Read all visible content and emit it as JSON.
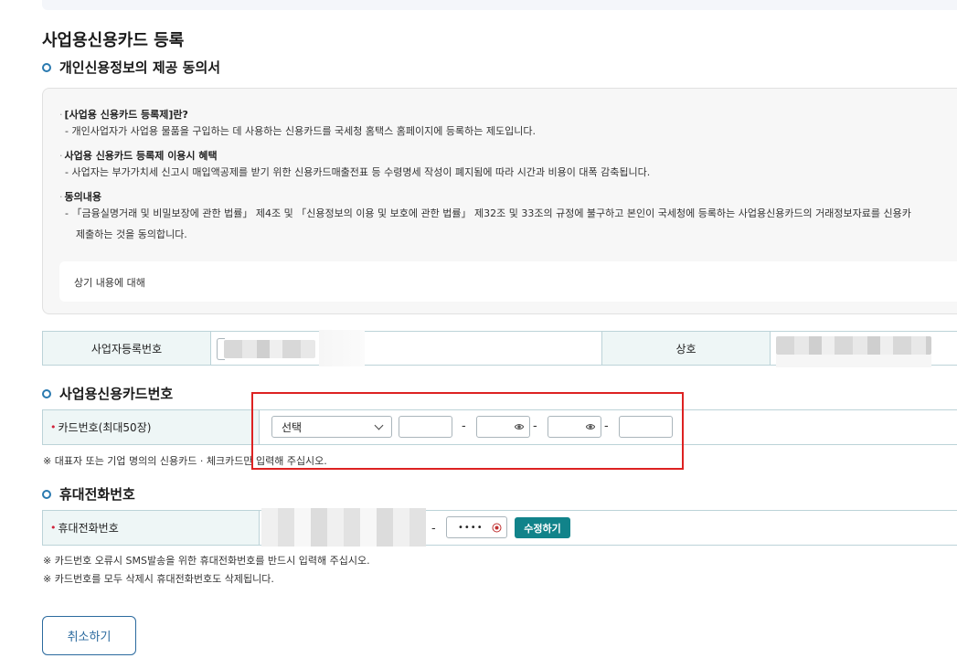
{
  "page": {
    "title": "사업용신용카드 등록"
  },
  "consent": {
    "section_title": "개인신용정보의 제공 동의서",
    "items": [
      {
        "heading": "[사업용 신용카드 등록제]란?",
        "body": "- 개인사업자가 사업용 물품을 구입하는 데 사용하는 신용카드를 국세청 홈택스 홈페이지에 등록하는 제도입니다."
      },
      {
        "heading": "사업용 신용카드 등록제 이용시 혜택",
        "body": "- 사업자는 부가가치세 신고시 매입액공제를 받기 위한 신용카드매출전표 등 수령명세 작성이 폐지됨에 따라 시간과 비용이 대폭 감축됩니다."
      },
      {
        "heading": "동의내용",
        "body": "- 「금융실명거래 및 비밀보장에 관한 법률」 제4조 및 「신용정보의 이용 및 보호에 관한 법률」 제32조 및 33조의 규정에 불구하고 본인이 국세청에 등록하는 사업용신용카드의   거래정보자료를 신용카",
        "body2": "제출하는 것을 동의합니다."
      }
    ],
    "agree_text": "상기 내용에 대해"
  },
  "business": {
    "reg_no_label": "사업자등록번호",
    "name_label": "상호"
  },
  "card": {
    "section_title": "사업용신용카드번호",
    "label": "카드번호(최대50장)",
    "select_value": "선택",
    "dash": "-",
    "note": "※ 대표자 또는 기업 명의의 신용카드 · 체크카드만 입력해 주십시오."
  },
  "phone": {
    "section_title": "휴대전화번호",
    "label": "휴대전화번호",
    "dash": "-",
    "masked": "••••",
    "edit_button": "수정하기",
    "notes": [
      "※ 카드번호 오류시 SMS발송을 위한 휴대전화번호를 반드시 입력해 주십시오.",
      "※ 카드번호를 모두 삭제시 휴대전화번호도 삭제됩니다."
    ]
  },
  "actions": {
    "cancel": "취소하기"
  },
  "colors": {
    "accent": "#11838a",
    "header_cell": "#eef6f6",
    "highlight": "#dd2222",
    "link": "#2b6a9e"
  }
}
